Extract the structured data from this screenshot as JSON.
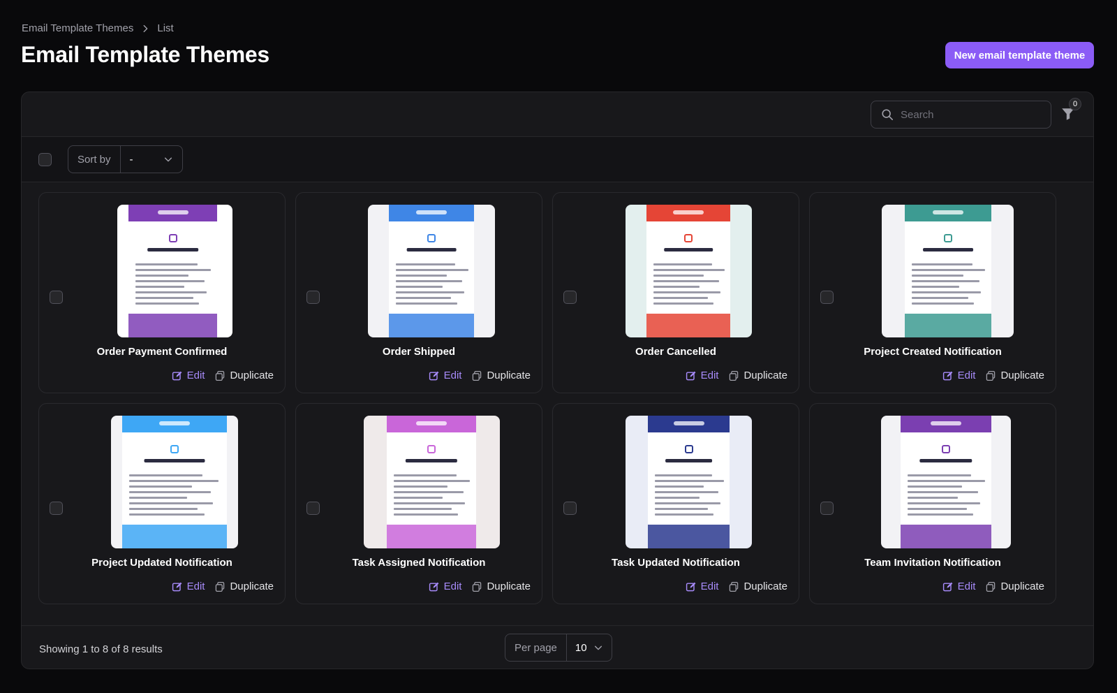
{
  "breadcrumb": {
    "parent": "Email Template Themes",
    "current": "List"
  },
  "page": {
    "title": "Email Template Themes",
    "new_button": "New email template theme"
  },
  "search": {
    "placeholder": "Search"
  },
  "filter": {
    "count": "0"
  },
  "sort": {
    "label": "Sort by",
    "value": "-"
  },
  "cards": [
    {
      "title": "Order Payment Confirmed",
      "accent": "#7e3fb5",
      "edit": "Edit",
      "duplicate": "Duplicate"
    },
    {
      "title": "Order Shipped",
      "accent": "#3f86e6",
      "edit": "Edit",
      "duplicate": "Duplicate"
    },
    {
      "title": "Order Cancelled",
      "accent": "#e54536",
      "edit": "Edit",
      "duplicate": "Duplicate"
    },
    {
      "title": "Project Created Notification",
      "accent": "#3d9b92",
      "edit": "Edit",
      "duplicate": "Duplicate"
    },
    {
      "title": "Project Updated Notification",
      "accent": "#3ea7f5",
      "edit": "Edit",
      "duplicate": "Duplicate"
    },
    {
      "title": "Task Assigned Notification",
      "accent": "#c966d9",
      "edit": "Edit",
      "duplicate": "Duplicate"
    },
    {
      "title": "Task Updated Notification",
      "accent": "#2b3a8f",
      "edit": "Edit",
      "duplicate": "Duplicate"
    },
    {
      "title": "Team Invitation Notification",
      "accent": "#7b3fb1",
      "edit": "Edit",
      "duplicate": "Duplicate"
    }
  ],
  "footer": {
    "results": "Showing 1 to 8 of 8 results",
    "per_page_label": "Per page",
    "per_page_value": "10"
  }
}
